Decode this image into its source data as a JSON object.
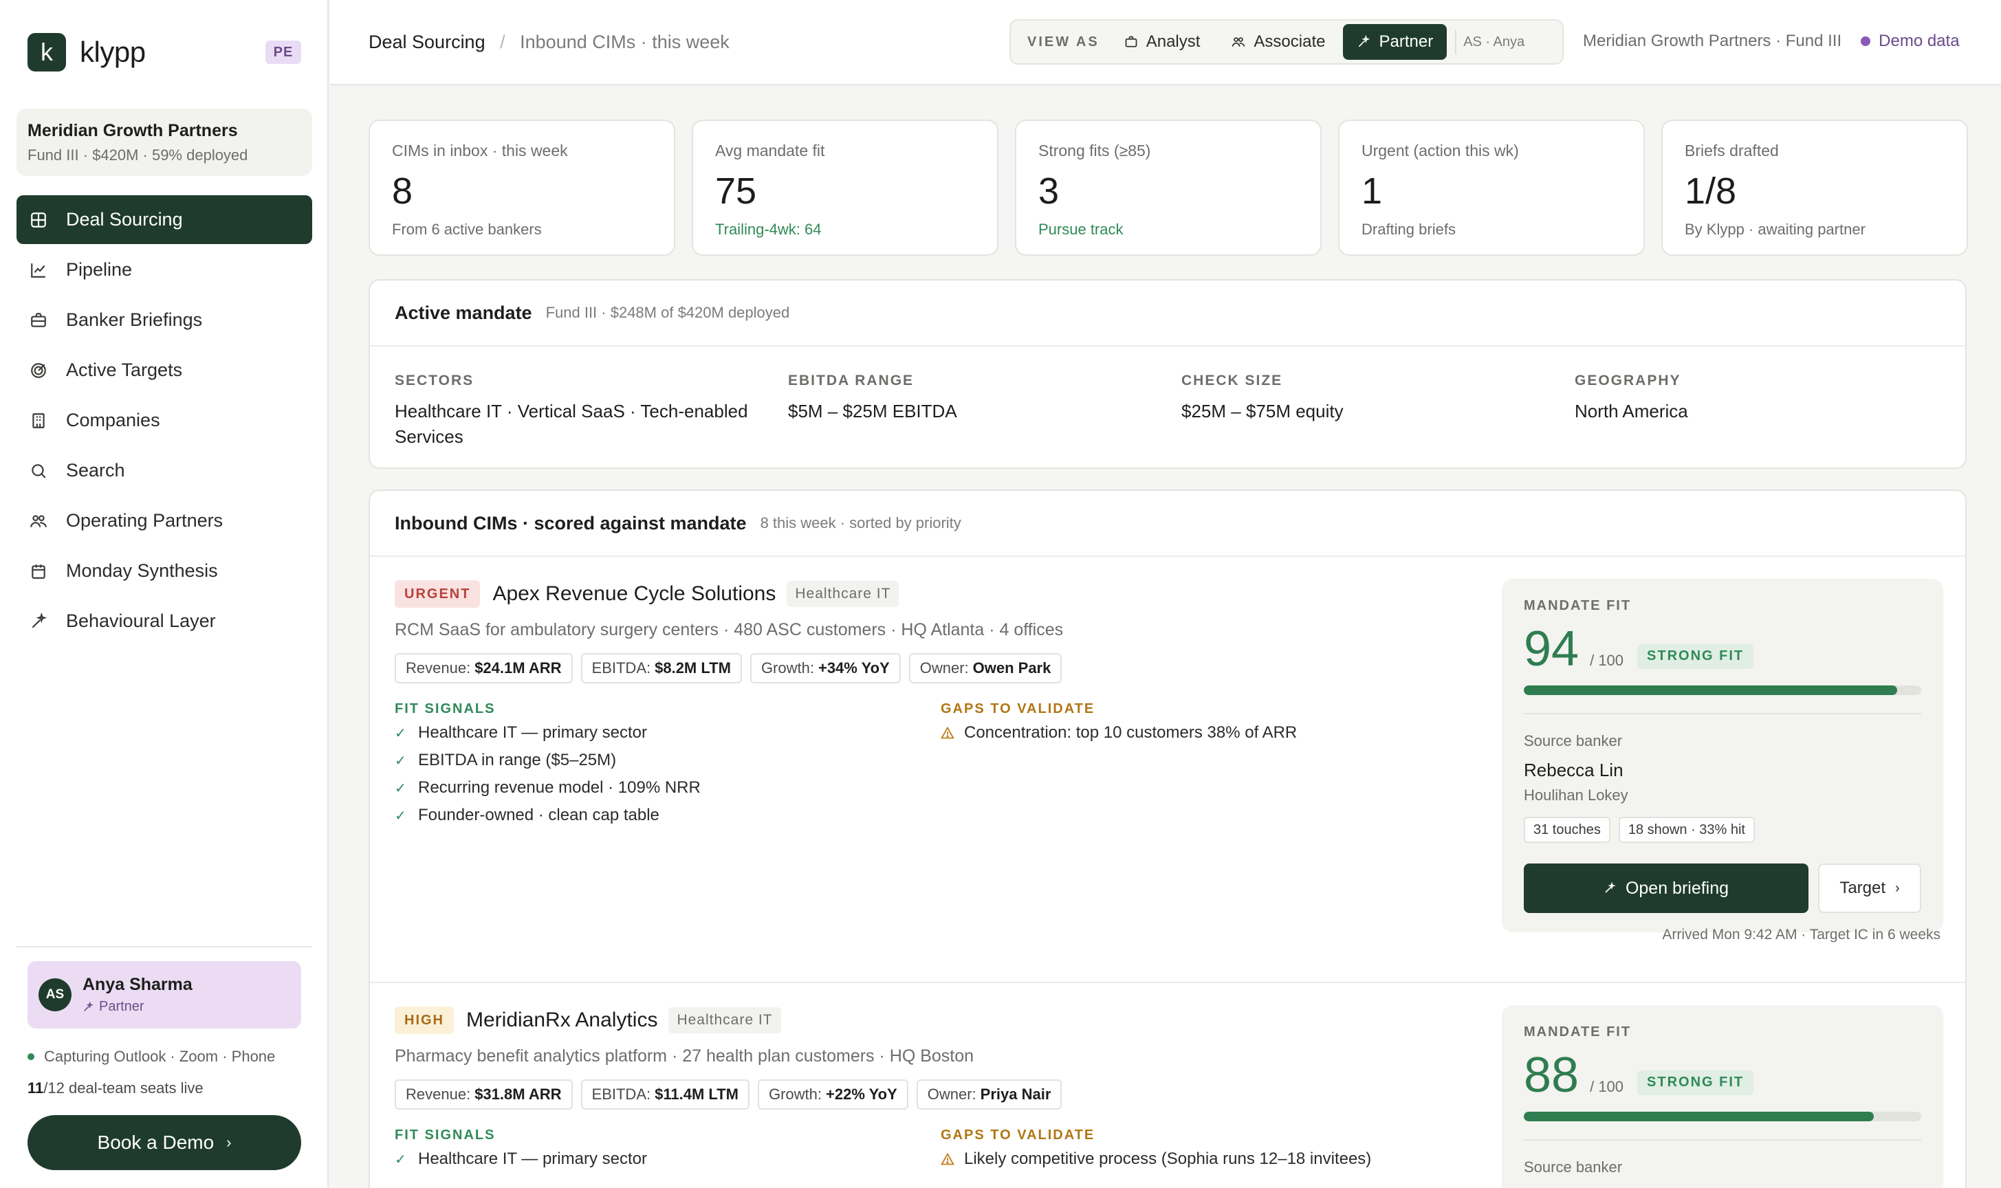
{
  "brand": {
    "logo_letter": "k",
    "name": "klypp",
    "badge": "PE"
  },
  "fund": {
    "name": "Meridian Growth Partners",
    "details": "Fund III · $420M · 59% deployed"
  },
  "nav": [
    {
      "label": "Deal Sourcing",
      "icon": "grid-icon",
      "active": true
    },
    {
      "label": "Pipeline",
      "icon": "chart-line-icon"
    },
    {
      "label": "Banker Briefings",
      "icon": "briefcase-icon"
    },
    {
      "label": "Active Targets",
      "icon": "target-icon"
    },
    {
      "label": "Companies",
      "icon": "building-icon"
    },
    {
      "label": "Search",
      "icon": "search-icon"
    },
    {
      "label": "Operating Partners",
      "icon": "people-icon"
    },
    {
      "label": "Monday Synthesis",
      "icon": "calendar-icon"
    },
    {
      "label": "Behavioural Layer",
      "icon": "sparkle-icon"
    }
  ],
  "user": {
    "initials": "AS",
    "name": "Anya Sharma",
    "role": "Partner"
  },
  "capture_status": "Capturing Outlook · Zoom · Phone",
  "seats": {
    "live": "11",
    "total": "/12",
    "suffix": "deal-team seats live"
  },
  "book_demo": "Book a Demo",
  "breadcrumb": {
    "section": "Deal Sourcing",
    "sep": "/",
    "page": "Inbound CIMs · this week"
  },
  "view_as": {
    "label": "VIEW AS",
    "roles": [
      {
        "label": "Analyst",
        "icon": "briefcase-icon"
      },
      {
        "label": "Associate",
        "icon": "people-icon"
      },
      {
        "label": "Partner",
        "icon": "sparkle-icon",
        "active": true
      }
    ],
    "user": "AS · Anya"
  },
  "topright": {
    "fund": "Meridian Growth Partners · Fund III",
    "demo": "Demo data"
  },
  "stats": [
    {
      "label": "CIMs in inbox · this week",
      "value": "8",
      "sub": "From 6 active bankers",
      "accent": false
    },
    {
      "label": "Avg mandate fit",
      "value": "75",
      "sub": "Trailing-4wk: 64",
      "accent": true
    },
    {
      "label": "Strong fits (≥85)",
      "value": "3",
      "sub": "Pursue track",
      "accent": true
    },
    {
      "label": "Urgent (action this wk)",
      "value": "1",
      "sub": "Drafting briefs",
      "accent": false
    },
    {
      "label": "Briefs drafted",
      "value": "1/8",
      "sub": "By Klypp · awaiting partner",
      "accent": false
    }
  ],
  "mandate": {
    "title": "Active mandate",
    "meta": "Fund III · $248M of $420M deployed",
    "columns": [
      {
        "label": "SECTORS",
        "value": "Healthcare IT · Vertical SaaS · Tech-enabled Services"
      },
      {
        "label": "EBITDA RANGE",
        "value": "$5M – $25M EBITDA"
      },
      {
        "label": "CHECK SIZE",
        "value": "$25M – $75M equity"
      },
      {
        "label": "GEOGRAPHY",
        "value": "North America"
      }
    ]
  },
  "inbound": {
    "title": "Inbound CIMs · scored against mandate",
    "meta": "8 this week · sorted by priority",
    "labels": {
      "fit_signals": "FIT SIGNALS",
      "gaps": "GAPS TO VALIDATE",
      "mandate_fit": "MANDATE FIT",
      "max": "/ 100",
      "source_banker": "Source banker",
      "open_briefing": "Open briefing",
      "target": "Target"
    },
    "deals": [
      {
        "priority": "URGENT",
        "name": "Apex Revenue Cycle Solutions",
        "sector": "Healthcare IT",
        "description": "RCM SaaS for ambulatory surgery centers · 480 ASC customers · HQ Atlanta · 4 offices",
        "metrics": [
          {
            "k": "Revenue:",
            "v": "$24.1M ARR"
          },
          {
            "k": "EBITDA:",
            "v": "$8.2M LTM"
          },
          {
            "k": "Growth:",
            "v": "+34% YoY"
          },
          {
            "k": "Owner:",
            "v": "Owen Park"
          }
        ],
        "fit_signals": [
          "Healthcare IT — primary sector",
          "EBITDA in range ($5–25M)",
          "Recurring revenue model · 109% NRR",
          "Founder-owned · clean cap table"
        ],
        "gaps": [
          "Concentration: top 10 customers 38% of ARR"
        ],
        "score": 94,
        "fit_badge": "STRONG FIT",
        "banker": {
          "name": "Rebecca Lin",
          "firm": "Houlihan Lokey",
          "touches": "31 touches",
          "hit": "18 shown · 33% hit"
        },
        "arrived": "Arrived Mon 9:42 AM · Target IC in 6 weeks"
      },
      {
        "priority": "HIGH",
        "name": "MeridianRx Analytics",
        "sector": "Healthcare IT",
        "description": "Pharmacy benefit analytics platform · 27 health plan customers · HQ Boston",
        "metrics": [
          {
            "k": "Revenue:",
            "v": "$31.8M ARR"
          },
          {
            "k": "EBITDA:",
            "v": "$11.4M LTM"
          },
          {
            "k": "Growth:",
            "v": "+22% YoY"
          },
          {
            "k": "Owner:",
            "v": "Priya Nair"
          }
        ],
        "fit_signals": [
          "Healthcare IT — primary sector"
        ],
        "gaps": [
          "Likely competitive process (Sophia runs 12–18 invitees)"
        ],
        "score": 88,
        "fit_badge": "STRONG FIT",
        "banker": {
          "name": "",
          "firm": "",
          "touches": "",
          "hit": ""
        },
        "arrived": ""
      }
    ]
  },
  "colors": {
    "brand_green": "#1f3b2e",
    "score_green": "#2f7d50",
    "urgent": "#b8413b",
    "high": "#a66d12",
    "demo_purple": "#6b4a8a"
  }
}
